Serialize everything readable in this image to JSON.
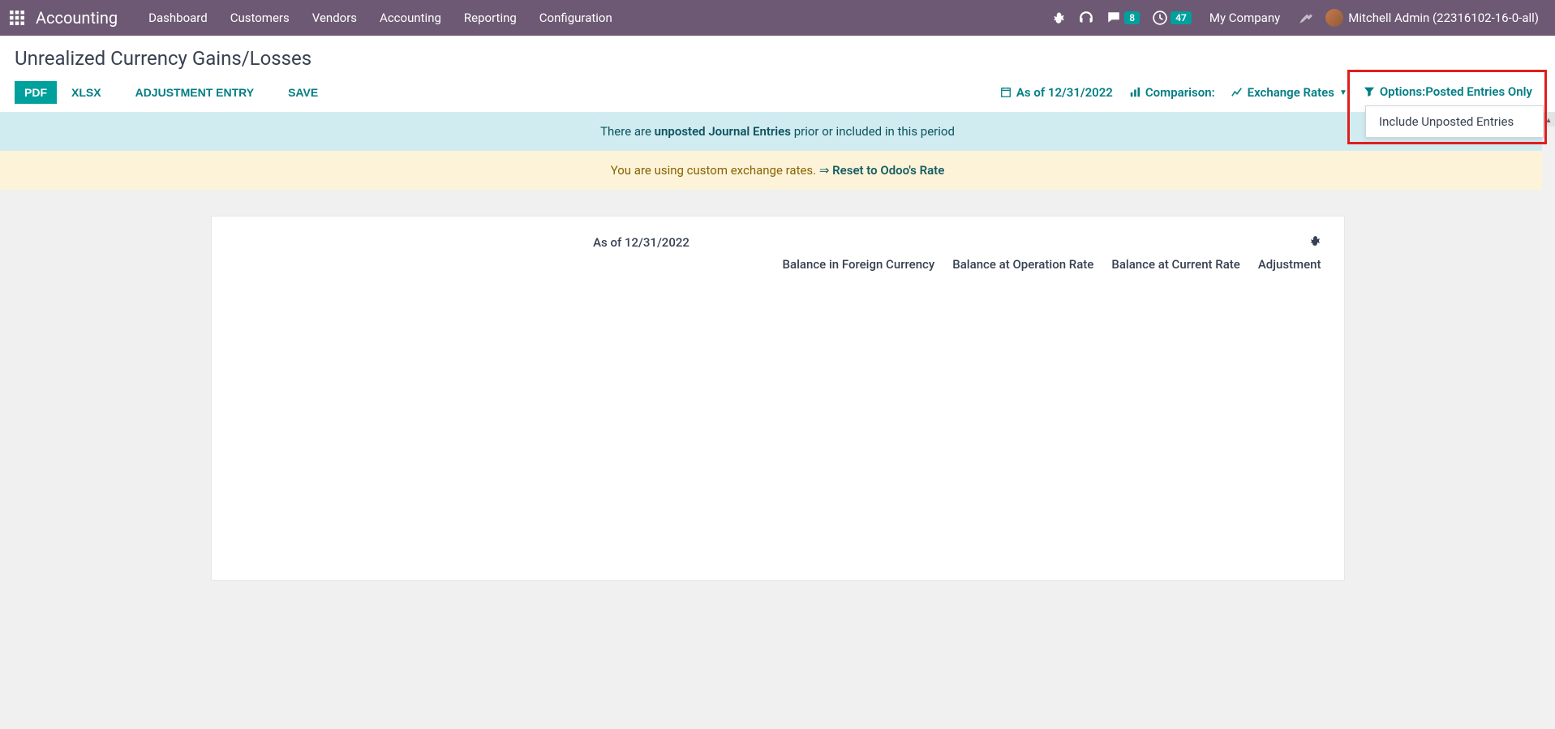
{
  "navbar": {
    "app_name": "Accounting",
    "items": [
      "Dashboard",
      "Customers",
      "Vendors",
      "Accounting",
      "Reporting",
      "Configuration"
    ],
    "messages_count": "8",
    "activities_count": "47",
    "company": "My Company",
    "user": "Mitchell Admin (22316102-16-0-all)"
  },
  "page": {
    "title": "Unrealized Currency Gains/Losses"
  },
  "toolbar": {
    "pdf": "PDF",
    "xlsx": "XLSX",
    "adjustment": "ADJUSTMENT ENTRY",
    "save": "SAVE",
    "asof": "As of 12/31/2022",
    "comparison": "Comparison:",
    "exchange_rates": "Exchange Rates",
    "options_label": "Options:",
    "options_value": "Posted Entries Only",
    "dropdown_item": "Include Unposted Entries"
  },
  "alerts": {
    "info_pre": "There are ",
    "info_link": "unposted Journal Entries",
    "info_post": " prior or included in this period",
    "warn_pre": "You are using custom exchange rates. ",
    "warn_arrow": "⇒ ",
    "warn_link": "Reset to Odoo's Rate"
  },
  "report": {
    "asof": "As of 12/31/2022",
    "columns": [
      "Balance in Foreign Currency",
      "Balance at Operation Rate",
      "Balance at Current Rate",
      "Adjustment"
    ]
  }
}
